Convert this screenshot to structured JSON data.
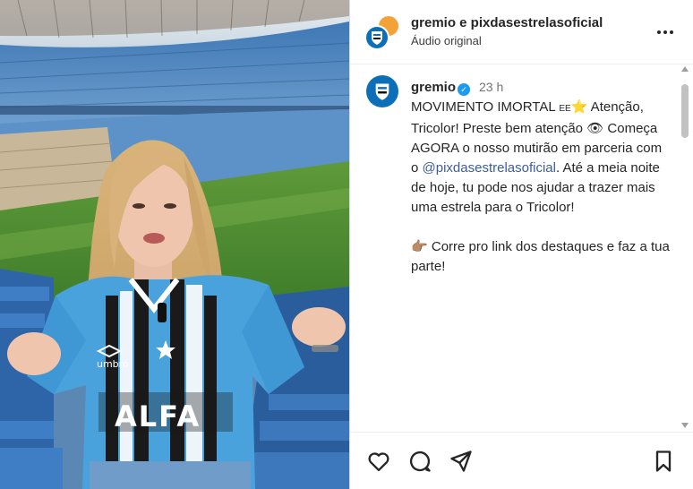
{
  "header": {
    "names": "gremio e pixdasestrelasoficial",
    "subtitle": "Áudio original"
  },
  "caption": {
    "username": "gremio",
    "time": "23 h",
    "lines": {
      "l1": "MOVIMENTO IMORTAL",
      "ee": "EE",
      "star": "⭐",
      "l1b": " Atenção, Tricolor! Preste bem atenção ",
      "eye": "👁",
      "l2": "Começa AGORA o nosso mutirão em parceria com o ",
      "mention": "@pixdasestrelasoficial",
      "l2b": ". Até a meia noite de hoje, tu pode nos ajudar a trazer mais uma estrela para o Tricolor!",
      "hand": "👉🏽",
      "l3": " Corre pro link dos destaques e faz a tua parte!"
    }
  },
  "jersey": {
    "sponsor": "ALFA",
    "brand": "umbro"
  },
  "colors": {
    "brand_blue": "#0d6fb8",
    "mention": "#3b5e9a",
    "verified": "#1d9bf0"
  },
  "icons": [
    "heart-icon",
    "comment-icon",
    "share-icon",
    "bookmark-icon",
    "more-options-icon",
    "verified-badge-icon"
  ]
}
